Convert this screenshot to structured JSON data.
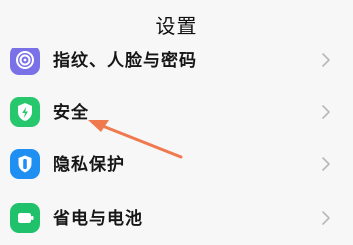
{
  "header": {
    "title": "设置"
  },
  "settings": {
    "items": [
      {
        "label": "指纹、人脸与密码",
        "icon": "fingerprint-icon",
        "color": "#7b71e6"
      },
      {
        "label": "安全",
        "icon": "shield-lightning-icon",
        "color": "#27c86d"
      },
      {
        "label": "隐私保护",
        "icon": "privacy-shield-icon",
        "color": "#1f8ff2"
      },
      {
        "label": "省电与电池",
        "icon": "battery-icon",
        "color": "#1fc26a"
      }
    ]
  },
  "annotation": {
    "arrow_color": "#f07a4f"
  }
}
